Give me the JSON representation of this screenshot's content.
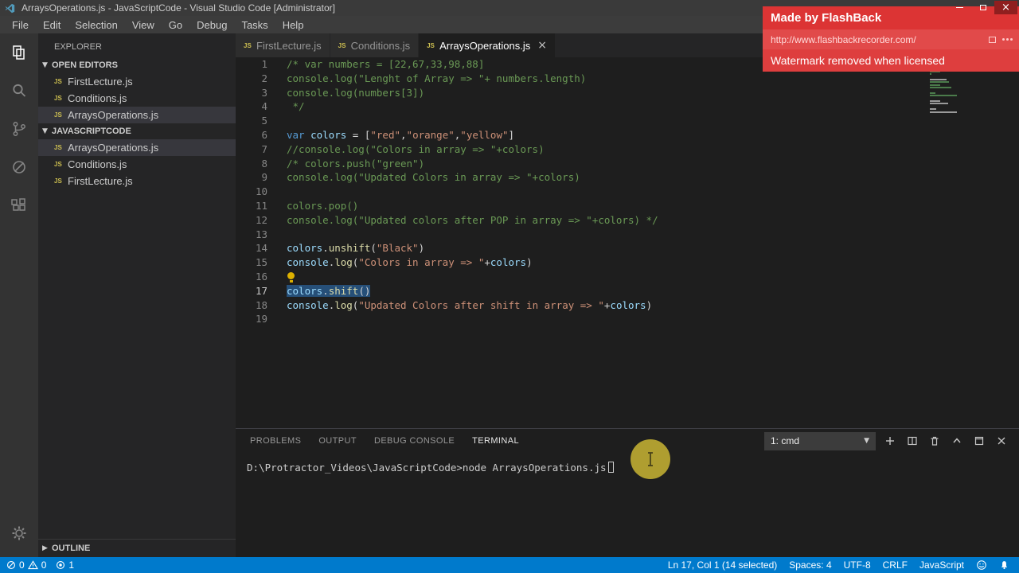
{
  "window": {
    "title": "ArraysOperations.js - JavaScriptCode - Visual Studio Code [Administrator]",
    "menus": [
      "File",
      "Edit",
      "Selection",
      "View",
      "Go",
      "Debug",
      "Tasks",
      "Help"
    ]
  },
  "watermark": {
    "title": "Made by FlashBack",
    "url": "http://www.flashbackrecorder.com/",
    "note": "Watermark removed when licensed"
  },
  "sidebar": {
    "title": "EXPLORER",
    "sections": {
      "open_editors": {
        "label": "OPEN EDITORS",
        "items": [
          {
            "label": "FirstLecture.js",
            "selected": false
          },
          {
            "label": "Conditions.js",
            "selected": false
          },
          {
            "label": "ArraysOperations.js",
            "selected": true
          }
        ]
      },
      "folder": {
        "label": "JAVASCRIPTCODE",
        "items": [
          {
            "label": "ArraysOperations.js",
            "selected": true
          },
          {
            "label": "Conditions.js",
            "selected": false
          },
          {
            "label": "FirstLecture.js",
            "selected": false
          }
        ]
      },
      "outline": {
        "label": "OUTLINE"
      }
    }
  },
  "tabs": [
    {
      "label": "FirstLecture.js",
      "active": false
    },
    {
      "label": "Conditions.js",
      "active": false
    },
    {
      "label": "ArraysOperations.js",
      "active": true
    }
  ],
  "editor": {
    "lines": [
      {
        "n": 1,
        "tokens": [
          {
            "t": "comment",
            "s": "/* var numbers = [22,67,33,98,88]"
          }
        ]
      },
      {
        "n": 2,
        "tokens": [
          {
            "t": "comment",
            "s": "console.log(\"Lenght of Array => \"+ numbers.length)"
          }
        ]
      },
      {
        "n": 3,
        "tokens": [
          {
            "t": "comment",
            "s": "console.log(numbers[3])"
          }
        ]
      },
      {
        "n": 4,
        "tokens": [
          {
            "t": "comment",
            "s": " */"
          }
        ]
      },
      {
        "n": 5,
        "tokens": []
      },
      {
        "n": 6,
        "tokens": [
          {
            "t": "keyword",
            "s": "var"
          },
          {
            "t": "plain",
            "s": " "
          },
          {
            "t": "var",
            "s": "colors"
          },
          {
            "t": "plain",
            "s": " = ["
          },
          {
            "t": "string",
            "s": "\"red\""
          },
          {
            "t": "plain",
            "s": ","
          },
          {
            "t": "string",
            "s": "\"orange\""
          },
          {
            "t": "plain",
            "s": ","
          },
          {
            "t": "string",
            "s": "\"yellow\""
          },
          {
            "t": "plain",
            "s": "]"
          }
        ]
      },
      {
        "n": 7,
        "tokens": [
          {
            "t": "comment",
            "s": "//console.log(\"Colors in array => \"+colors)"
          }
        ]
      },
      {
        "n": 8,
        "tokens": [
          {
            "t": "comment",
            "s": "/* colors.push(\"green\")"
          }
        ]
      },
      {
        "n": 9,
        "tokens": [
          {
            "t": "comment",
            "s": "console.log(\"Updated Colors in array => \"+colors)"
          }
        ]
      },
      {
        "n": 10,
        "tokens": []
      },
      {
        "n": 11,
        "tokens": [
          {
            "t": "comment",
            "s": "colors.pop()"
          }
        ]
      },
      {
        "n": 12,
        "tokens": [
          {
            "t": "comment",
            "s": "console.log(\"Updated colors after POP in array => \"+colors) */"
          }
        ]
      },
      {
        "n": 13,
        "tokens": []
      },
      {
        "n": 14,
        "tokens": [
          {
            "t": "var",
            "s": "colors"
          },
          {
            "t": "plain",
            "s": "."
          },
          {
            "t": "fn",
            "s": "unshift"
          },
          {
            "t": "plain",
            "s": "("
          },
          {
            "t": "string",
            "s": "\"Black\""
          },
          {
            "t": "plain",
            "s": ")"
          }
        ]
      },
      {
        "n": 15,
        "tokens": [
          {
            "t": "var",
            "s": "console"
          },
          {
            "t": "plain",
            "s": "."
          },
          {
            "t": "fn",
            "s": "log"
          },
          {
            "t": "plain",
            "s": "("
          },
          {
            "t": "string",
            "s": "\"Colors in array => \""
          },
          {
            "t": "plain",
            "s": "+"
          },
          {
            "t": "var",
            "s": "colors"
          },
          {
            "t": "plain",
            "s": ")"
          }
        ]
      },
      {
        "n": 16,
        "lightbulb": true,
        "tokens": []
      },
      {
        "n": 17,
        "selected": true,
        "active": true,
        "tokens": [
          {
            "t": "var",
            "s": "colors"
          },
          {
            "t": "plain",
            "s": "."
          },
          {
            "t": "fn",
            "s": "shift"
          },
          {
            "t": "plain",
            "s": "()"
          }
        ]
      },
      {
        "n": 18,
        "tokens": [
          {
            "t": "var",
            "s": "console"
          },
          {
            "t": "plain",
            "s": "."
          },
          {
            "t": "fn",
            "s": "log"
          },
          {
            "t": "plain",
            "s": "("
          },
          {
            "t": "string",
            "s": "\"Updated Colors after shift in array => \""
          },
          {
            "t": "plain",
            "s": "+"
          },
          {
            "t": "var",
            "s": "colors"
          },
          {
            "t": "plain",
            "s": ")"
          }
        ]
      },
      {
        "n": 19,
        "tokens": []
      }
    ]
  },
  "panel": {
    "tabs": [
      {
        "label": "PROBLEMS",
        "active": false
      },
      {
        "label": "OUTPUT",
        "active": false
      },
      {
        "label": "DEBUG CONSOLE",
        "active": false
      },
      {
        "label": "TERMINAL",
        "active": true
      }
    ],
    "terminal_selector": "1: cmd",
    "terminal_line": "D:\\Protractor_Videos\\JavaScriptCode>node ArraysOperations.js"
  },
  "status_bar": {
    "errors": "0",
    "warnings": "0",
    "indicator": "1",
    "cursor": "Ln 17, Col 1 (14 selected)",
    "spaces": "Spaces: 4",
    "encoding": "UTF-8",
    "eol": "CRLF",
    "language": "JavaScript"
  }
}
